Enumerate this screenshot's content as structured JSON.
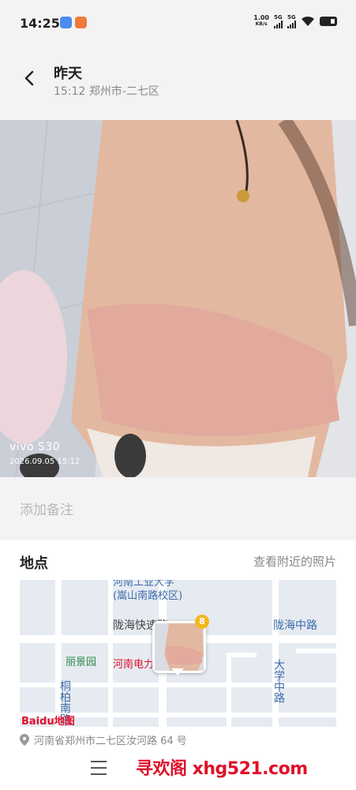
{
  "status_bar": {
    "time": "14:25",
    "net_speed_value": "1.00",
    "net_speed_unit": "KB/s",
    "sim1": "5G",
    "sim2": "5G"
  },
  "header": {
    "title": "昨天",
    "subtitle": "15:12 郑州市-二七区"
  },
  "photo": {
    "device": "vivo S30",
    "timestamp": "2026.09.05 15:12"
  },
  "note": {
    "placeholder": "添加备注"
  },
  "location": {
    "title": "地点",
    "nearby_link": "查看附近的照片",
    "address": "河南省郑州市二七区汝河路 64 号",
    "map": {
      "photo_count": "8",
      "labels": [
        "河南工业大学",
        "(嵩山南路校区)",
        "陇海快速路",
        "陇海中路",
        "丽景园",
        "河南电力",
        "大学中路",
        "桐柏南路"
      ],
      "logo": "Baidu地图"
    }
  },
  "bottom": {
    "watermark": "寻欢阁 xhg521.com"
  },
  "colors": {
    "map_road": "#ffffff",
    "map_bg": "#e6ebf2",
    "map_label": "#3a6aa8",
    "badge": "#f3b81e",
    "watermark": "#e0102a"
  }
}
